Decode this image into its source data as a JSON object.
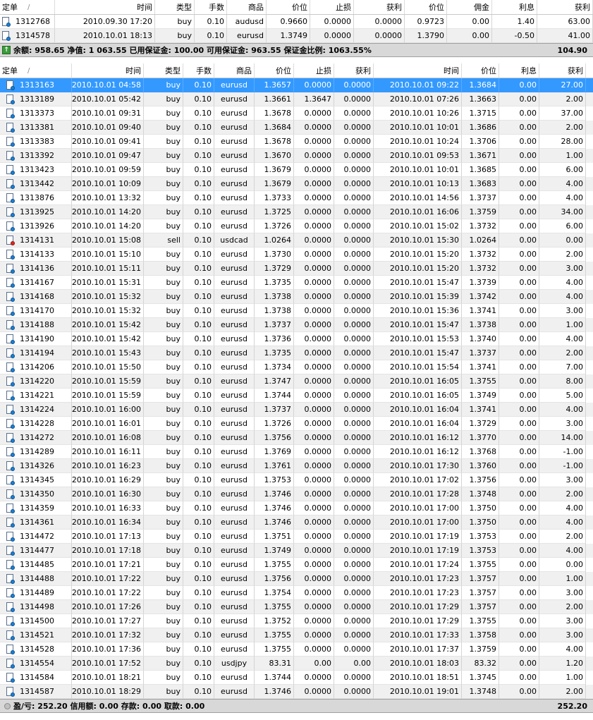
{
  "top_table": {
    "headers": {
      "ticket": "定单",
      "sort": "/",
      "time": "时间",
      "type": "类型",
      "lots": "手数",
      "symbol": "商品",
      "price": "价位",
      "sl": "止损",
      "tp": "获利",
      "cur_price": "价位",
      "commission": "佣金",
      "swap": "利息",
      "profit": "获利"
    },
    "rows": [
      {
        "ticket": "1312768",
        "time": "2010.09.30 17:20",
        "type": "buy",
        "lots": "0.10",
        "symbol": "audusd",
        "price": "0.9660",
        "sl": "0.0000",
        "tp": "0.0000",
        "cur_price": "0.9723",
        "commission": "0.00",
        "swap": "1.40",
        "profit": "63.00"
      },
      {
        "ticket": "1314578",
        "time": "2010.10.01 18:13",
        "type": "buy",
        "lots": "0.10",
        "symbol": "eurusd",
        "price": "1.3749",
        "sl": "0.0000",
        "tp": "0.0000",
        "cur_price": "1.3790",
        "commission": "0.00",
        "swap": "-0.50",
        "profit": "41.00"
      }
    ],
    "summary_text": "余额: 958.65  净值: 1 063.55  已用保证金: 100.00  可用保证金: 963.55  保证金比例: 1063.55%",
    "summary_total": "104.90"
  },
  "history_table": {
    "headers": {
      "ticket": "定单",
      "sort": "/",
      "open_time": "时间",
      "type": "类型",
      "lots": "手数",
      "symbol": "商品",
      "open_price": "价位",
      "sl": "止损",
      "tp": "获利",
      "close_time": "时间",
      "close_price": "价位",
      "swap": "利息",
      "profit": "获利"
    },
    "rows": [
      {
        "ticket": "1313163",
        "open_time": "2010.10.01 04:58",
        "type": "buy",
        "lots": "0.10",
        "symbol": "eurusd",
        "open_price": "1.3657",
        "sl": "0.0000",
        "tp": "0.0000",
        "close_time": "2010.10.01 09:22",
        "close_price": "1.3684",
        "swap": "0.00",
        "profit": "27.00"
      },
      {
        "ticket": "1313189",
        "open_time": "2010.10.01 05:42",
        "type": "buy",
        "lots": "0.10",
        "symbol": "eurusd",
        "open_price": "1.3661",
        "sl": "1.3647",
        "tp": "0.0000",
        "close_time": "2010.10.01 07:26",
        "close_price": "1.3663",
        "swap": "0.00",
        "profit": "2.00"
      },
      {
        "ticket": "1313373",
        "open_time": "2010.10.01 09:31",
        "type": "buy",
        "lots": "0.10",
        "symbol": "eurusd",
        "open_price": "1.3678",
        "sl": "0.0000",
        "tp": "0.0000",
        "close_time": "2010.10.01 10:26",
        "close_price": "1.3715",
        "swap": "0.00",
        "profit": "37.00"
      },
      {
        "ticket": "1313381",
        "open_time": "2010.10.01 09:40",
        "type": "buy",
        "lots": "0.10",
        "symbol": "eurusd",
        "open_price": "1.3684",
        "sl": "0.0000",
        "tp": "0.0000",
        "close_time": "2010.10.01 10:01",
        "close_price": "1.3686",
        "swap": "0.00",
        "profit": "2.00"
      },
      {
        "ticket": "1313383",
        "open_time": "2010.10.01 09:41",
        "type": "buy",
        "lots": "0.10",
        "symbol": "eurusd",
        "open_price": "1.3678",
        "sl": "0.0000",
        "tp": "0.0000",
        "close_time": "2010.10.01 10:24",
        "close_price": "1.3706",
        "swap": "0.00",
        "profit": "28.00"
      },
      {
        "ticket": "1313392",
        "open_time": "2010.10.01 09:47",
        "type": "buy",
        "lots": "0.10",
        "symbol": "eurusd",
        "open_price": "1.3670",
        "sl": "0.0000",
        "tp": "0.0000",
        "close_time": "2010.10.01 09:53",
        "close_price": "1.3671",
        "swap": "0.00",
        "profit": "1.00"
      },
      {
        "ticket": "1313423",
        "open_time": "2010.10.01 09:59",
        "type": "buy",
        "lots": "0.10",
        "symbol": "eurusd",
        "open_price": "1.3679",
        "sl": "0.0000",
        "tp": "0.0000",
        "close_time": "2010.10.01 10:01",
        "close_price": "1.3685",
        "swap": "0.00",
        "profit": "6.00"
      },
      {
        "ticket": "1313442",
        "open_time": "2010.10.01 10:09",
        "type": "buy",
        "lots": "0.10",
        "symbol": "eurusd",
        "open_price": "1.3679",
        "sl": "0.0000",
        "tp": "0.0000",
        "close_time": "2010.10.01 10:13",
        "close_price": "1.3683",
        "swap": "0.00",
        "profit": "4.00"
      },
      {
        "ticket": "1313876",
        "open_time": "2010.10.01 13:32",
        "type": "buy",
        "lots": "0.10",
        "symbol": "eurusd",
        "open_price": "1.3733",
        "sl": "0.0000",
        "tp": "0.0000",
        "close_time": "2010.10.01 14:56",
        "close_price": "1.3737",
        "swap": "0.00",
        "profit": "4.00"
      },
      {
        "ticket": "1313925",
        "open_time": "2010.10.01 14:20",
        "type": "buy",
        "lots": "0.10",
        "symbol": "eurusd",
        "open_price": "1.3725",
        "sl": "0.0000",
        "tp": "0.0000",
        "close_time": "2010.10.01 16:06",
        "close_price": "1.3759",
        "swap": "0.00",
        "profit": "34.00"
      },
      {
        "ticket": "1313926",
        "open_time": "2010.10.01 14:20",
        "type": "buy",
        "lots": "0.10",
        "symbol": "eurusd",
        "open_price": "1.3726",
        "sl": "0.0000",
        "tp": "0.0000",
        "close_time": "2010.10.01 15:02",
        "close_price": "1.3732",
        "swap": "0.00",
        "profit": "6.00"
      },
      {
        "ticket": "1314131",
        "open_time": "2010.10.01 15:08",
        "type": "sell",
        "lots": "0.10",
        "symbol": "usdcad",
        "open_price": "1.0264",
        "sl": "0.0000",
        "tp": "0.0000",
        "close_time": "2010.10.01 15:30",
        "close_price": "1.0264",
        "swap": "0.00",
        "profit": "0.00"
      },
      {
        "ticket": "1314133",
        "open_time": "2010.10.01 15:10",
        "type": "buy",
        "lots": "0.10",
        "symbol": "eurusd",
        "open_price": "1.3730",
        "sl": "0.0000",
        "tp": "0.0000",
        "close_time": "2010.10.01 15:20",
        "close_price": "1.3732",
        "swap": "0.00",
        "profit": "2.00"
      },
      {
        "ticket": "1314136",
        "open_time": "2010.10.01 15:11",
        "type": "buy",
        "lots": "0.10",
        "symbol": "eurusd",
        "open_price": "1.3729",
        "sl": "0.0000",
        "tp": "0.0000",
        "close_time": "2010.10.01 15:20",
        "close_price": "1.3732",
        "swap": "0.00",
        "profit": "3.00"
      },
      {
        "ticket": "1314167",
        "open_time": "2010.10.01 15:31",
        "type": "buy",
        "lots": "0.10",
        "symbol": "eurusd",
        "open_price": "1.3735",
        "sl": "0.0000",
        "tp": "0.0000",
        "close_time": "2010.10.01 15:47",
        "close_price": "1.3739",
        "swap": "0.00",
        "profit": "4.00"
      },
      {
        "ticket": "1314168",
        "open_time": "2010.10.01 15:32",
        "type": "buy",
        "lots": "0.10",
        "symbol": "eurusd",
        "open_price": "1.3738",
        "sl": "0.0000",
        "tp": "0.0000",
        "close_time": "2010.10.01 15:39",
        "close_price": "1.3742",
        "swap": "0.00",
        "profit": "4.00"
      },
      {
        "ticket": "1314170",
        "open_time": "2010.10.01 15:32",
        "type": "buy",
        "lots": "0.10",
        "symbol": "eurusd",
        "open_price": "1.3738",
        "sl": "0.0000",
        "tp": "0.0000",
        "close_time": "2010.10.01 15:36",
        "close_price": "1.3741",
        "swap": "0.00",
        "profit": "3.00"
      },
      {
        "ticket": "1314188",
        "open_time": "2010.10.01 15:42",
        "type": "buy",
        "lots": "0.10",
        "symbol": "eurusd",
        "open_price": "1.3737",
        "sl": "0.0000",
        "tp": "0.0000",
        "close_time": "2010.10.01 15:47",
        "close_price": "1.3738",
        "swap": "0.00",
        "profit": "1.00"
      },
      {
        "ticket": "1314190",
        "open_time": "2010.10.01 15:42",
        "type": "buy",
        "lots": "0.10",
        "symbol": "eurusd",
        "open_price": "1.3736",
        "sl": "0.0000",
        "tp": "0.0000",
        "close_time": "2010.10.01 15:53",
        "close_price": "1.3740",
        "swap": "0.00",
        "profit": "4.00"
      },
      {
        "ticket": "1314194",
        "open_time": "2010.10.01 15:43",
        "type": "buy",
        "lots": "0.10",
        "symbol": "eurusd",
        "open_price": "1.3735",
        "sl": "0.0000",
        "tp": "0.0000",
        "close_time": "2010.10.01 15:47",
        "close_price": "1.3737",
        "swap": "0.00",
        "profit": "2.00"
      },
      {
        "ticket": "1314206",
        "open_time": "2010.10.01 15:50",
        "type": "buy",
        "lots": "0.10",
        "symbol": "eurusd",
        "open_price": "1.3734",
        "sl": "0.0000",
        "tp": "0.0000",
        "close_time": "2010.10.01 15:54",
        "close_price": "1.3741",
        "swap": "0.00",
        "profit": "7.00"
      },
      {
        "ticket": "1314220",
        "open_time": "2010.10.01 15:59",
        "type": "buy",
        "lots": "0.10",
        "symbol": "eurusd",
        "open_price": "1.3747",
        "sl": "0.0000",
        "tp": "0.0000",
        "close_time": "2010.10.01 16:05",
        "close_price": "1.3755",
        "swap": "0.00",
        "profit": "8.00"
      },
      {
        "ticket": "1314221",
        "open_time": "2010.10.01 15:59",
        "type": "buy",
        "lots": "0.10",
        "symbol": "eurusd",
        "open_price": "1.3744",
        "sl": "0.0000",
        "tp": "0.0000",
        "close_time": "2010.10.01 16:05",
        "close_price": "1.3749",
        "swap": "0.00",
        "profit": "5.00"
      },
      {
        "ticket": "1314224",
        "open_time": "2010.10.01 16:00",
        "type": "buy",
        "lots": "0.10",
        "symbol": "eurusd",
        "open_price": "1.3737",
        "sl": "0.0000",
        "tp": "0.0000",
        "close_time": "2010.10.01 16:04",
        "close_price": "1.3741",
        "swap": "0.00",
        "profit": "4.00"
      },
      {
        "ticket": "1314228",
        "open_time": "2010.10.01 16:01",
        "type": "buy",
        "lots": "0.10",
        "symbol": "eurusd",
        "open_price": "1.3726",
        "sl": "0.0000",
        "tp": "0.0000",
        "close_time": "2010.10.01 16:04",
        "close_price": "1.3729",
        "swap": "0.00",
        "profit": "3.00"
      },
      {
        "ticket": "1314272",
        "open_time": "2010.10.01 16:08",
        "type": "buy",
        "lots": "0.10",
        "symbol": "eurusd",
        "open_price": "1.3756",
        "sl": "0.0000",
        "tp": "0.0000",
        "close_time": "2010.10.01 16:12",
        "close_price": "1.3770",
        "swap": "0.00",
        "profit": "14.00"
      },
      {
        "ticket": "1314289",
        "open_time": "2010.10.01 16:11",
        "type": "buy",
        "lots": "0.10",
        "symbol": "eurusd",
        "open_price": "1.3769",
        "sl": "0.0000",
        "tp": "0.0000",
        "close_time": "2010.10.01 16:12",
        "close_price": "1.3768",
        "swap": "0.00",
        "profit": "-1.00"
      },
      {
        "ticket": "1314326",
        "open_time": "2010.10.01 16:23",
        "type": "buy",
        "lots": "0.10",
        "symbol": "eurusd",
        "open_price": "1.3761",
        "sl": "0.0000",
        "tp": "0.0000",
        "close_time": "2010.10.01 17:30",
        "close_price": "1.3760",
        "swap": "0.00",
        "profit": "-1.00"
      },
      {
        "ticket": "1314345",
        "open_time": "2010.10.01 16:29",
        "type": "buy",
        "lots": "0.10",
        "symbol": "eurusd",
        "open_price": "1.3753",
        "sl": "0.0000",
        "tp": "0.0000",
        "close_time": "2010.10.01 17:02",
        "close_price": "1.3756",
        "swap": "0.00",
        "profit": "3.00"
      },
      {
        "ticket": "1314350",
        "open_time": "2010.10.01 16:30",
        "type": "buy",
        "lots": "0.10",
        "symbol": "eurusd",
        "open_price": "1.3746",
        "sl": "0.0000",
        "tp": "0.0000",
        "close_time": "2010.10.01 17:28",
        "close_price": "1.3748",
        "swap": "0.00",
        "profit": "2.00"
      },
      {
        "ticket": "1314359",
        "open_time": "2010.10.01 16:33",
        "type": "buy",
        "lots": "0.10",
        "symbol": "eurusd",
        "open_price": "1.3746",
        "sl": "0.0000",
        "tp": "0.0000",
        "close_time": "2010.10.01 17:00",
        "close_price": "1.3750",
        "swap": "0.00",
        "profit": "4.00"
      },
      {
        "ticket": "1314361",
        "open_time": "2010.10.01 16:34",
        "type": "buy",
        "lots": "0.10",
        "symbol": "eurusd",
        "open_price": "1.3746",
        "sl": "0.0000",
        "tp": "0.0000",
        "close_time": "2010.10.01 17:00",
        "close_price": "1.3750",
        "swap": "0.00",
        "profit": "4.00"
      },
      {
        "ticket": "1314472",
        "open_time": "2010.10.01 17:13",
        "type": "buy",
        "lots": "0.10",
        "symbol": "eurusd",
        "open_price": "1.3751",
        "sl": "0.0000",
        "tp": "0.0000",
        "close_time": "2010.10.01 17:19",
        "close_price": "1.3753",
        "swap": "0.00",
        "profit": "2.00"
      },
      {
        "ticket": "1314477",
        "open_time": "2010.10.01 17:18",
        "type": "buy",
        "lots": "0.10",
        "symbol": "eurusd",
        "open_price": "1.3749",
        "sl": "0.0000",
        "tp": "0.0000",
        "close_time": "2010.10.01 17:19",
        "close_price": "1.3753",
        "swap": "0.00",
        "profit": "4.00"
      },
      {
        "ticket": "1314485",
        "open_time": "2010.10.01 17:21",
        "type": "buy",
        "lots": "0.10",
        "symbol": "eurusd",
        "open_price": "1.3755",
        "sl": "0.0000",
        "tp": "0.0000",
        "close_time": "2010.10.01 17:24",
        "close_price": "1.3755",
        "swap": "0.00",
        "profit": "0.00"
      },
      {
        "ticket": "1314488",
        "open_time": "2010.10.01 17:22",
        "type": "buy",
        "lots": "0.10",
        "symbol": "eurusd",
        "open_price": "1.3756",
        "sl": "0.0000",
        "tp": "0.0000",
        "close_time": "2010.10.01 17:23",
        "close_price": "1.3757",
        "swap": "0.00",
        "profit": "1.00"
      },
      {
        "ticket": "1314489",
        "open_time": "2010.10.01 17:22",
        "type": "buy",
        "lots": "0.10",
        "symbol": "eurusd",
        "open_price": "1.3754",
        "sl": "0.0000",
        "tp": "0.0000",
        "close_time": "2010.10.01 17:23",
        "close_price": "1.3757",
        "swap": "0.00",
        "profit": "3.00"
      },
      {
        "ticket": "1314498",
        "open_time": "2010.10.01 17:26",
        "type": "buy",
        "lots": "0.10",
        "symbol": "eurusd",
        "open_price": "1.3755",
        "sl": "0.0000",
        "tp": "0.0000",
        "close_time": "2010.10.01 17:29",
        "close_price": "1.3757",
        "swap": "0.00",
        "profit": "2.00"
      },
      {
        "ticket": "1314500",
        "open_time": "2010.10.01 17:27",
        "type": "buy",
        "lots": "0.10",
        "symbol": "eurusd",
        "open_price": "1.3752",
        "sl": "0.0000",
        "tp": "0.0000",
        "close_time": "2010.10.01 17:29",
        "close_price": "1.3755",
        "swap": "0.00",
        "profit": "3.00"
      },
      {
        "ticket": "1314521",
        "open_time": "2010.10.01 17:32",
        "type": "buy",
        "lots": "0.10",
        "symbol": "eurusd",
        "open_price": "1.3755",
        "sl": "0.0000",
        "tp": "0.0000",
        "close_time": "2010.10.01 17:33",
        "close_price": "1.3758",
        "swap": "0.00",
        "profit": "3.00"
      },
      {
        "ticket": "1314528",
        "open_time": "2010.10.01 17:36",
        "type": "buy",
        "lots": "0.10",
        "symbol": "eurusd",
        "open_price": "1.3755",
        "sl": "0.0000",
        "tp": "0.0000",
        "close_time": "2010.10.01 17:37",
        "close_price": "1.3759",
        "swap": "0.00",
        "profit": "4.00"
      },
      {
        "ticket": "1314554",
        "open_time": "2010.10.01 17:52",
        "type": "buy",
        "lots": "0.10",
        "symbol": "usdjpy",
        "open_price": "83.31",
        "sl": "0.00",
        "tp": "0.00",
        "close_time": "2010.10.01 18:03",
        "close_price": "83.32",
        "swap": "0.00",
        "profit": "1.20"
      },
      {
        "ticket": "1314584",
        "open_time": "2010.10.01 18:21",
        "type": "buy",
        "lots": "0.10",
        "symbol": "eurusd",
        "open_price": "1.3744",
        "sl": "0.0000",
        "tp": "0.0000",
        "close_time": "2010.10.01 18:51",
        "close_price": "1.3745",
        "swap": "0.00",
        "profit": "1.00"
      },
      {
        "ticket": "1314587",
        "open_time": "2010.10.01 18:29",
        "type": "buy",
        "lots": "0.10",
        "symbol": "eurusd",
        "open_price": "1.3746",
        "sl": "0.0000",
        "tp": "0.0000",
        "close_time": "2010.10.01 19:01",
        "close_price": "1.3748",
        "swap": "0.00",
        "profit": "2.00"
      }
    ],
    "summary_text": "盈/亏: 252.20  信用额: 0.00  存款: 0.00  取款: 0.00",
    "summary_total": "252.20"
  },
  "colors": {
    "selected_row": "#3399ff",
    "alt_row": "#f0f0f0",
    "summary_bar": "#d8d8d8",
    "buy_icon": "#1a7fd6",
    "sell_icon": "#e0281e"
  }
}
